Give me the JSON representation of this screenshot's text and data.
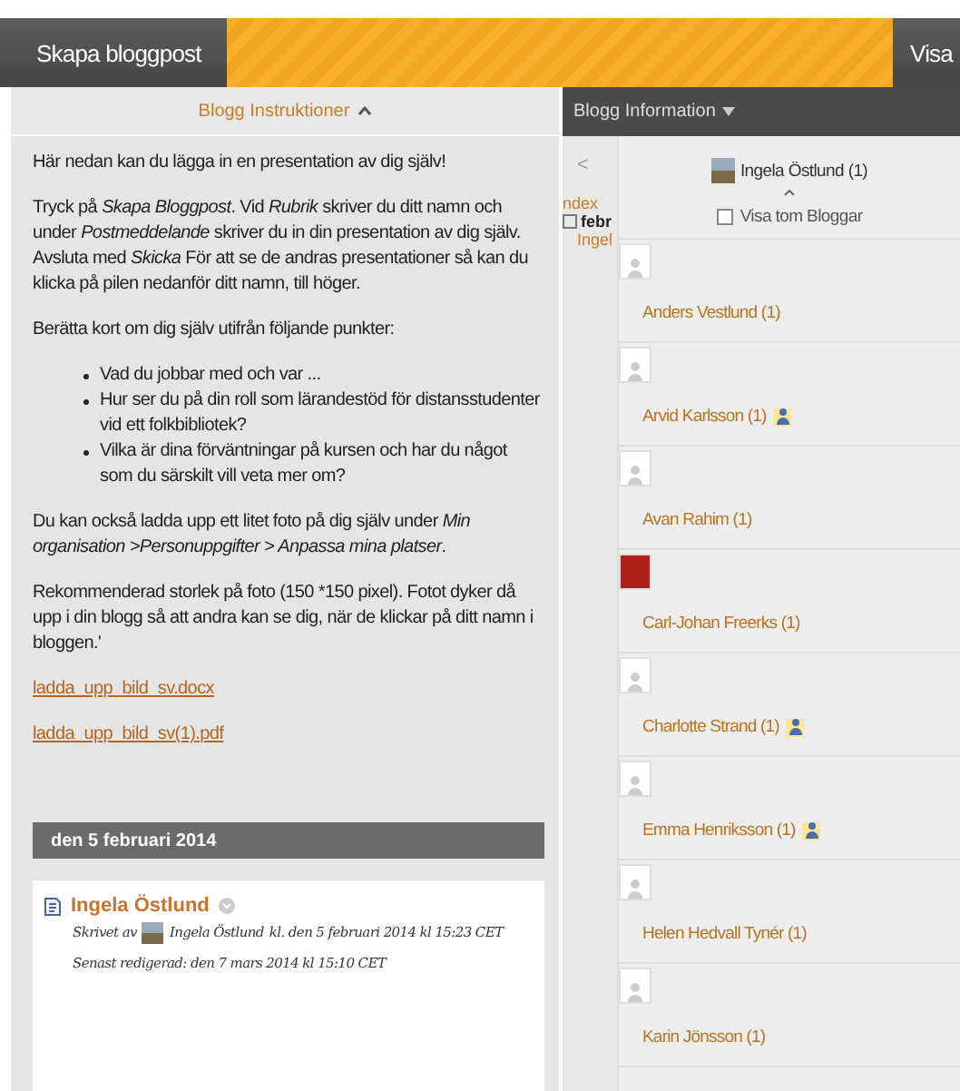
{
  "toolbar": {
    "create_button": "Skapa bloggpost",
    "right_button": "Visa"
  },
  "instructions": {
    "title": "Blogg Instruktioner",
    "expanded": true,
    "paragraphs_top": [
      "Här nedan kan du lägga in en presentation av dig själv!",
      "Tryck  på *Skapa Bloggpost*. Vid *Rubrik* skriver du ditt namn och under *Postmeddelande* skriver du in din presentation av dig själv. Avsluta med *Skicka* För att se de andras presentationer så kan du klicka på pilen nedanför ditt namn, till höger.",
      "Berätta kort om dig själv utifrån följande punkter:"
    ],
    "bullets": [
      "Vad du jobbar med och var ...",
      "Hur ser du på din roll som lärandestöd för distansstudenter vid ett folkbibliotek?",
      "Vilka är dina förväntningar på kursen och har du något som du särskilt vill veta mer om?"
    ],
    "paragraphs_bottom": [
      "Du kan också ladda upp ett litet foto på dig själv under *Min organisation >Personuppgifter > Anpassa mina platser*.",
      "Rekommenderad storlek på foto (150 *150 pixel). Fotot dyker då upp i din blogg så att andra kan se dig, när de klickar på ditt namn i bloggen.'"
    ],
    "links": [
      "ladda_upp_bild_sv.docx",
      "ladda_upp_bild_sv(1).pdf"
    ]
  },
  "date_header": "den 5 februari 2014",
  "post": {
    "title": "Ingela Östlund",
    "written_by": "Skrivet av",
    "author": "Ingela Östlund",
    "written_at": "kl. den 5 februari 2014 kl 15:23 CET",
    "edited": "Senast redigerad: den 7 mars 2014 kl 15:10 CET"
  },
  "blog_info": {
    "title": "Blogg Information",
    "back": "<",
    "tree": [
      "ndex",
      "febr",
      "Ingel"
    ],
    "current_user": "Ingela Östlund (1)",
    "show_empty": {
      "label": "Visa tom Bloggar",
      "checked": false
    },
    "users": [
      {
        "name": "Anders Vestlund (1)",
        "kind": "generic",
        "badge": false
      },
      {
        "name": "Arvid Karlsson (1)",
        "kind": "generic",
        "badge": true
      },
      {
        "name": "Avan Rahim (1)",
        "kind": "generic",
        "badge": false
      },
      {
        "name": "Carl-Johan Freerks (1)",
        "kind": "photo",
        "badge": false
      },
      {
        "name": "Charlotte Strand (1)",
        "kind": "generic",
        "badge": true
      },
      {
        "name": "Emma Henriksson (1)",
        "kind": "generic",
        "badge": true
      },
      {
        "name": "Helen Hedvall Tynér (1)",
        "kind": "generic",
        "badge": false
      },
      {
        "name": "Karin Jönsson (1)",
        "kind": "generic",
        "badge": false
      }
    ]
  }
}
